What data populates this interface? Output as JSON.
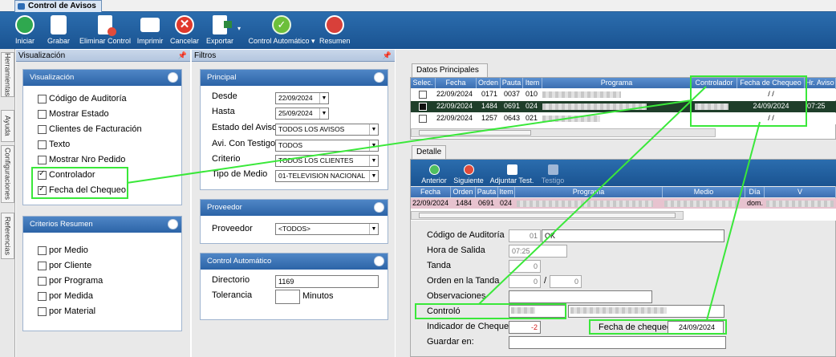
{
  "app": {
    "tab_title": "Control de Avisos"
  },
  "toolbar": {
    "buttons": [
      {
        "id": "iniciar",
        "label": "Iniciar",
        "color": "#2fa84f"
      },
      {
        "id": "grabar",
        "label": "Grabar",
        "color": "#2c5fa2"
      },
      {
        "id": "eliminar",
        "label": "Eliminar Control",
        "color": "#e14b3b"
      },
      {
        "id": "imprimir",
        "label": "Imprimir",
        "color": "#3a6fb4"
      },
      {
        "id": "cancelar",
        "label": "Cancelar",
        "color": "#e0392c"
      },
      {
        "id": "exportar",
        "label": "Exportar",
        "color": "#2e8a3e"
      },
      {
        "id": "control_auto",
        "label": "Control Automático",
        "color": "#6cbf3a"
      },
      {
        "id": "resumen",
        "label": "Resumen",
        "color": "#d8403a"
      }
    ]
  },
  "side_tabs": [
    "Herramientas",
    "Ayuda",
    "Configuraciones",
    "Referencias"
  ],
  "visualizacion": {
    "pane_title": "Visualización",
    "group_title": "Visualización",
    "options": [
      {
        "label": "Código de Auditoría",
        "checked": false
      },
      {
        "label": "Mostrar Estado",
        "checked": false
      },
      {
        "label": "Clientes de Facturación",
        "checked": false
      },
      {
        "label": "Texto",
        "checked": false
      },
      {
        "label": "Mostrar Nro Pedido",
        "checked": false
      },
      {
        "label": "Controlador",
        "checked": true
      },
      {
        "label": "Fecha del Chequeo",
        "checked": true
      }
    ],
    "resumen_title": "Criterios Resumen",
    "resumen_options": [
      {
        "label": "por Medio",
        "checked": false
      },
      {
        "label": "por Cliente",
        "checked": false
      },
      {
        "label": "por Programa",
        "checked": false
      },
      {
        "label": "por Medida",
        "checked": false
      },
      {
        "label": "por Material",
        "checked": false
      }
    ]
  },
  "filtros": {
    "pane_title": "Filtros",
    "principal_title": "Principal",
    "fields": [
      {
        "label": "Desde",
        "value": "22/09/2024"
      },
      {
        "label": "Hasta",
        "value": "25/09/2024"
      },
      {
        "label": "Estado del Aviso",
        "value": "TODOS LOS AVISOS"
      },
      {
        "label": "Avi. Con Testigo",
        "value": "TODOS"
      },
      {
        "label": "Criterio",
        "value": "TODOS LOS CLIENTES"
      },
      {
        "label": "Tipo de Medio",
        "value": "01-TELEVISION NACIONAL"
      }
    ],
    "proveedor_title": "Proveedor",
    "proveedor_label": "Proveedor",
    "proveedor_value": "<TODOS>",
    "control_title": "Control Automático",
    "directorio_label": "Directorio",
    "directorio_value": "1169",
    "tolerancia_label": "Tolerancia",
    "tolerancia_value": "",
    "minutos_label": "Minutos"
  },
  "datos": {
    "tab_label": "Datos Principales",
    "columns": [
      "Selec.",
      "Fecha",
      "Orden",
      "Pauta",
      "Item",
      "Programa",
      "Controlador",
      "Fecha de Chequeo",
      "Hr. Aviso"
    ],
    "rows": [
      {
        "fecha": "22/09/2024",
        "orden": "0171",
        "pauta": "0037",
        "item": "010",
        "fecha_chequeo": "/ /",
        "hr": "",
        "selected": false
      },
      {
        "fecha": "22/09/2024",
        "orden": "1484",
        "pauta": "0691",
        "item": "024",
        "fecha_chequeo": "24/09/2024",
        "hr": "07:25",
        "selected": true
      },
      {
        "fecha": "22/09/2024",
        "orden": "1257",
        "pauta": "0643",
        "item": "021",
        "fecha_chequeo": "/ /",
        "hr": "",
        "selected": false
      }
    ]
  },
  "detalle": {
    "tab_label": "Detalle",
    "buttons": [
      "Anterior",
      "Siguiente",
      "Adjuntar Test.",
      "Testigo"
    ],
    "columns": [
      "Fecha",
      "Orden",
      "Pauta",
      "Item",
      "Programa",
      "Medio",
      "Día",
      "V"
    ],
    "row": {
      "fecha": "22/09/2024",
      "orden": "1484",
      "pauta": "0691",
      "item": "024",
      "dia": "dom."
    },
    "fields": {
      "codigo_label": "Código de Auditoría",
      "codigo_num": "01",
      "codigo_val": "OK",
      "hora_label": "Hora de Salida",
      "hora_val": "07:25",
      "tanda_label": "Tanda",
      "tanda_val": "0",
      "orden_label": "Orden en la Tanda",
      "orden_val1": "0",
      "orden_sep": "/",
      "orden_val2": "0",
      "obs_label": "Observaciones",
      "controlo_label": "Controló",
      "indicador_label": "Indicador de Chequeo",
      "indicador_val": "-2",
      "fecha_chequeo_label": "Fecha de chequeo",
      "fecha_chequeo_val": "24/09/2024",
      "guardar_label": "Guardar en:"
    }
  }
}
